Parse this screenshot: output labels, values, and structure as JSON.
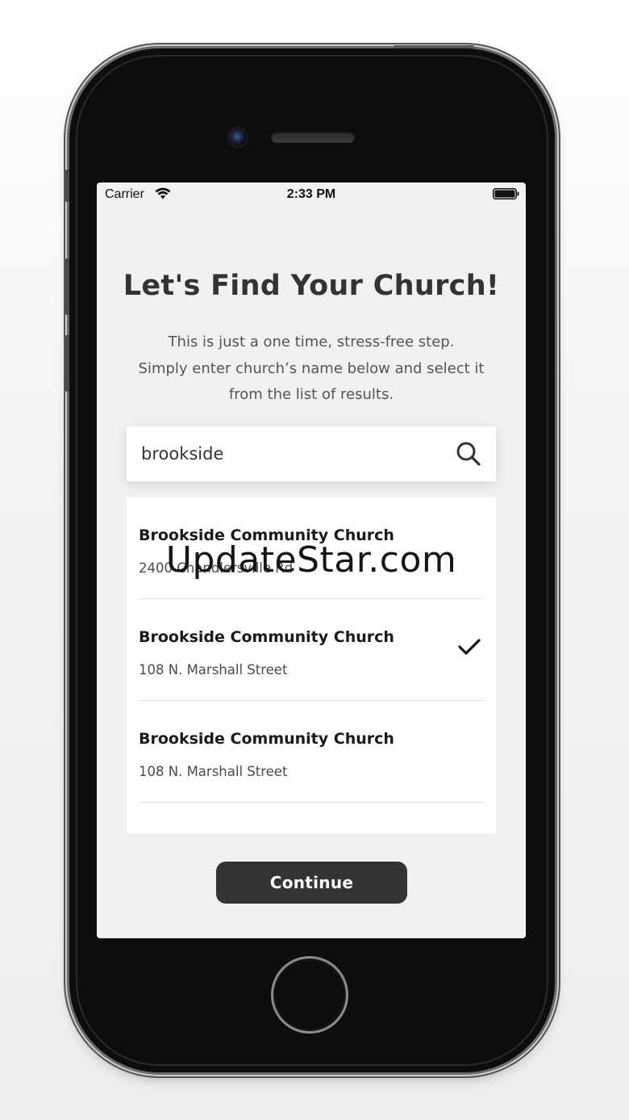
{
  "status_bar": {
    "carrier": "Carrier",
    "time": "2:33 PM"
  },
  "header": {
    "title": "Let's Find Your Church!",
    "subtitle_lines": [
      "This is just a one time, stress-free step.",
      "Simply enter church’s name below and select it",
      "from the list of results."
    ]
  },
  "search": {
    "value": "brookside",
    "icon": "search-icon"
  },
  "results": [
    {
      "name": "Brookside Community Church",
      "address": "2400 Chandlersville Rd",
      "selected": false
    },
    {
      "name": "Brookside Community Church",
      "address": "108 N. Marshall Street",
      "selected": true
    },
    {
      "name": "Brookside Community Church",
      "address": "108 N. Marshall Street",
      "selected": false
    }
  ],
  "continue_label": "Continue",
  "watermark": "UpdateStar.com",
  "colors": {
    "button_bg": "#333333",
    "screen_bg": "#f1f1f1",
    "title": "#333333"
  }
}
